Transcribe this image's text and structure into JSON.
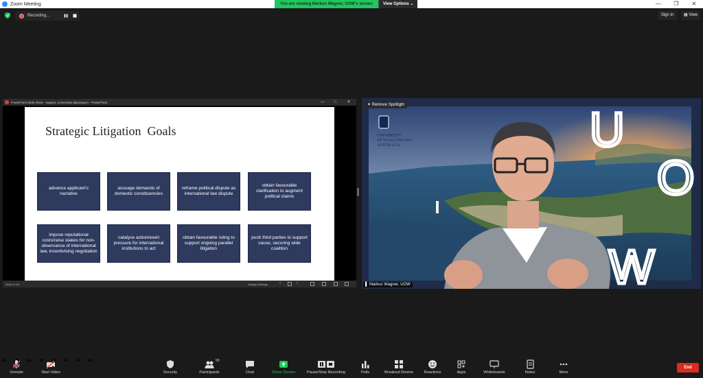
{
  "window": {
    "title": "Zoom Meeting"
  },
  "share_banner": {
    "message": "You are viewing Markus Wagner, UOW's screen",
    "view_options": "View Options"
  },
  "recording": {
    "label": "Recording..."
  },
  "header": {
    "sign_in": "Sign in",
    "view": "View"
  },
  "ppt": {
    "window_title": "PowerPoint Slide Show  -  wagner, universitas diponegoro  -  PowerPoint",
    "slide_title": "Strategic Litigation  Goals",
    "goals": [
      "advance applicant’s narrative",
      "assuage demands of domestic constituencies",
      "reframe political dispute as international law dispute",
      "obtain favourable clarification to augment political claims",
      "impose reputational costs/raise stakes for non-observance of international law, incentivising negotiation",
      "catalyse action/exert pressure for international institutions to act",
      "obtain favourable ruling to support ongoing parallel litigation",
      "push third parties to support cause, securing wide coalition"
    ],
    "status_slide": "Slide 3 of 8",
    "display_settings": "Display Settings"
  },
  "video": {
    "remove_spotlight": "Remove Spotlight",
    "participant_name": "Markus Wagner, UOW",
    "logo_lines": [
      "UNIVERSITY",
      "OF WOLLONGONG",
      "AUSTRALIA"
    ],
    "bg_letters": [
      "U",
      "O",
      "W"
    ]
  },
  "toolbar": {
    "unmute": "Unmute",
    "start_video": "Start Video",
    "security": "Security",
    "participants": "Participants",
    "participants_count": "93",
    "chat": "Chat",
    "share_screen": "Share Screen",
    "pause_stop_recording": "Pause/Stop Recording",
    "polls": "Polls",
    "breakout_rooms": "Breakout Rooms",
    "reactions": "Reactions",
    "apps": "Apps",
    "whiteboards": "Whiteboards",
    "notes": "Notes",
    "more": "More",
    "end": "End"
  },
  "colors": {
    "zoom_blue": "#2d8cff",
    "share_green": "#22c55e",
    "end_red": "#d92d20",
    "goal_box": "#2f3a5f"
  }
}
